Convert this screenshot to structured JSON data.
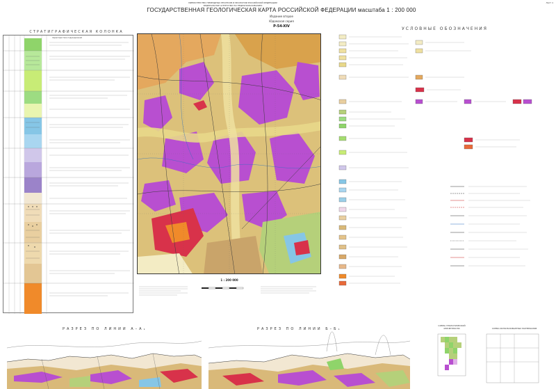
{
  "header": {
    "ministry_lines": [
      "МИНИСТЕРСТВО ПРИРОДНЫХ РЕСУРСОВ И ЭКОЛОГИИ РОССИЙСКОЙ ФЕДЕРАЦИИ",
      "ФЕДЕРАЛЬНОЕ АГЕНТСТВО ПО НЕДРОПОЛЬЗОВАНИЮ"
    ],
    "title": "ГОСУДАРСТВЕННАЯ ГЕОЛОГИЧЕСКАЯ КАРТА РОССИЙСКОЙ ФЕДЕРАЦИИ  масштаба 1 : 200 000",
    "edition": "Издание второе",
    "series": "Юдомская серия",
    "sheet_code": "P-54-XIV",
    "sheet_number": "Лист 1"
  },
  "stratigraphy": {
    "title": "СТРАТИГРАФИЧЕСКАЯ КОЛОНКА",
    "column_header": "Характеристика подразделений"
  },
  "legend": {
    "title": "УСЛОВНЫЕ  ОБОЗНАЧЕНИЯ"
  },
  "map": {
    "scale_label": "1 : 200 000"
  },
  "sections": {
    "section_1_title": "РАЗРЕЗ ПО ЛИНИИ  А–А₁",
    "section_2_title": "РАЗРЕЗ ПО ЛИНИИ  Б–Б₁"
  },
  "schemes": {
    "index_title": "СХЕМА ГЕОЛОГИЧЕСКОЙ ИЗУЧЕННОСТИ",
    "scheme_title": "СХЕМА ИСПОЛЬЗОВАННЫХ МАТЕРИАЛОВ"
  },
  "colors": {
    "granite_magenta": "#b84fd0",
    "jurassic_yellow": "#e8d88a",
    "triassic_green": "#b5d07a",
    "quaternary_pale": "#f3ecc4",
    "intrusive_red": "#d8324a",
    "tan": "#d9b979"
  }
}
